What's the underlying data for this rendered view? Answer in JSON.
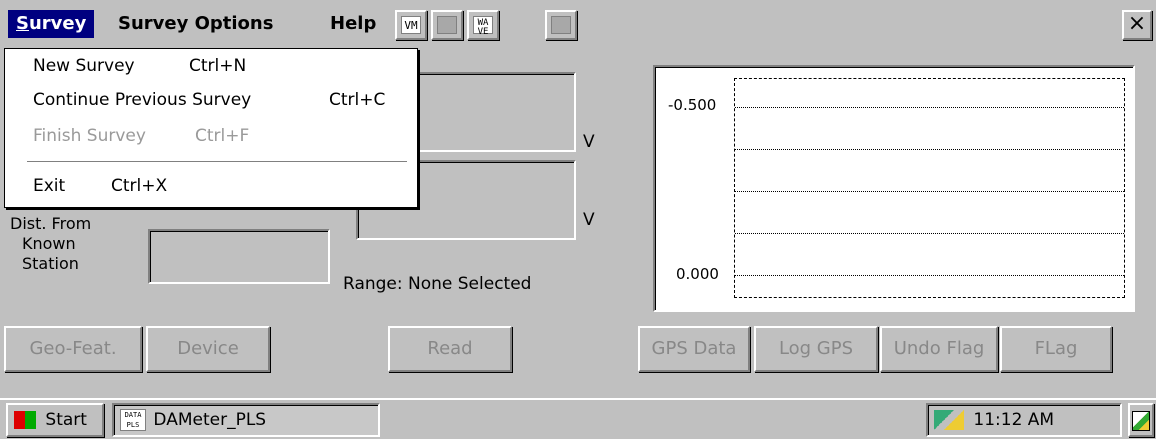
{
  "menubar": {
    "items": [
      "Survey",
      "Survey Options",
      "Help"
    ],
    "toolbar": {
      "vm": "VM",
      "wave": "WA VE"
    },
    "close": "×"
  },
  "dropdown": {
    "items": [
      {
        "label": "New Survey",
        "shortcut": "Ctrl+N",
        "enabled": true
      },
      {
        "label": "Continue Previous Survey",
        "shortcut": "Ctrl+C",
        "enabled": true
      },
      {
        "label": "Finish Survey",
        "shortcut": "Ctrl+F",
        "enabled": false
      },
      {
        "label": "Exit",
        "shortcut": "Ctrl+X",
        "enabled": true
      }
    ]
  },
  "fields": {
    "unit1": "V",
    "unit2": "V",
    "dist_label_1": "Dist. From",
    "dist_label_2": "Known",
    "dist_label_3": "Station",
    "range_text": "Range: None Selected"
  },
  "chart_data": {
    "type": "line",
    "y_ticks": [
      "-0.500",
      "0.000"
    ],
    "series": [],
    "grid": true
  },
  "buttons": {
    "geo_feat": "Geo-Feat.",
    "device": "Device",
    "read": "Read",
    "gps_data": "GPS Data",
    "log_gps": "Log GPS",
    "undo_flag": "Undo Flag",
    "flag": "FLag"
  },
  "taskbar": {
    "start": "Start",
    "app_icon": "DATA PLS",
    "app": "DAMeter_PLS",
    "time": "11:12 AM"
  },
  "colors": {
    "menu_highlight": "#000080",
    "background": "#c0c0c0"
  }
}
